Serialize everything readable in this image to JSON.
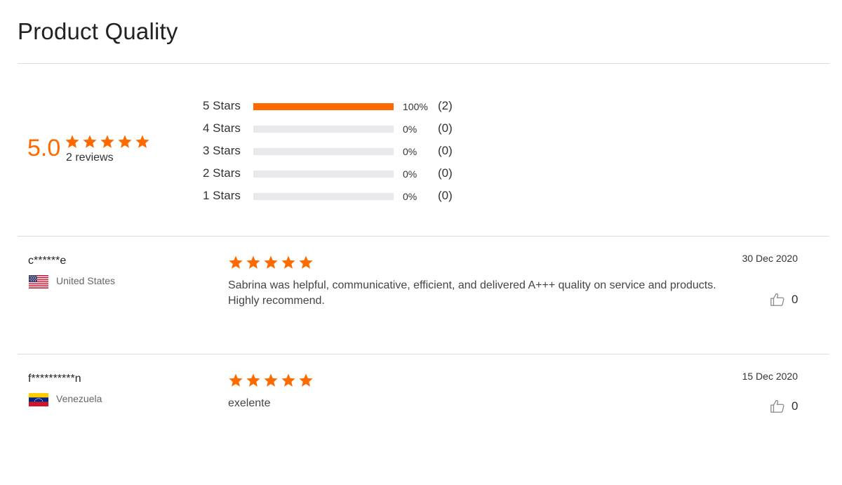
{
  "page": {
    "title": "Product Quality"
  },
  "summary": {
    "average": "5.0",
    "rating_stars": 5,
    "reviews_label": "2 reviews",
    "distribution": [
      {
        "label": "5  Stars",
        "fraction": 1.0,
        "percent_label": "100%",
        "count_label": "(2)"
      },
      {
        "label": "4  Stars",
        "fraction": 0.0,
        "percent_label": "0%",
        "count_label": "(0)"
      },
      {
        "label": "3  Stars",
        "fraction": 0.0,
        "percent_label": "0%",
        "count_label": "(0)"
      },
      {
        "label": "2  Stars",
        "fraction": 0.0,
        "percent_label": "0%",
        "count_label": "(0)"
      },
      {
        "label": "1  Stars",
        "fraction": 0.0,
        "percent_label": "0%",
        "count_label": "(0)"
      }
    ]
  },
  "reviews": [
    {
      "name": "c******e",
      "flag_icon": "flag-us-icon",
      "country": "United States",
      "rating_stars": 5,
      "text": "Sabrina was helpful, communicative, efficient, and delivered A+++ quality on service and products. Highly recommend.",
      "date": "30 Dec 2020",
      "helpful_count": "0"
    },
    {
      "name": "f**********n",
      "flag_icon": "flag-venezuela-icon",
      "country": "Venezuela",
      "rating_stars": 5,
      "text": "exelente",
      "date": "15 Dec 2020",
      "helpful_count": "0"
    }
  ],
  "colors": {
    "accent": "#ff6a00",
    "track": "#e8e8ed",
    "divider": "#dcdcdc"
  }
}
